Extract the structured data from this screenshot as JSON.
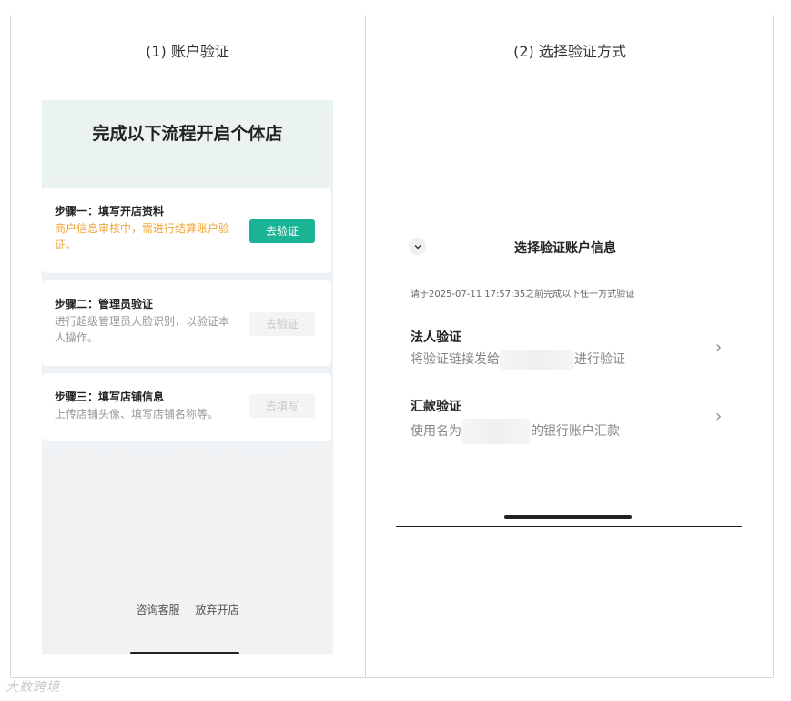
{
  "headers": {
    "col1": "(1) 账户验证",
    "col2": "(2) 选择验证方式"
  },
  "left_phone": {
    "title": "完成以下流程开启个体店",
    "steps": [
      {
        "title": "步骤一：填写开店资料",
        "desc": "商户信息审核中，需进行结算账户验证。",
        "button": "去验证",
        "desc_color": "#f0a53a",
        "button_state": "active"
      },
      {
        "title": "步骤二：管理员验证",
        "desc": "进行超级管理员人脸识别，以验证本人操作。",
        "button": "去验证",
        "button_state": "disabled"
      },
      {
        "title": "步骤三：填写店铺信息",
        "desc": "上传店铺头像、填写店铺名称等。",
        "button": "去填写",
        "button_state": "disabled"
      }
    ],
    "footer": {
      "consult": "咨询客服",
      "abandon": "放弃开店"
    }
  },
  "right_panel": {
    "title": "选择验证账户信息",
    "note": "请于2025-07-11 17:57:35之前完成以下任一方式验证",
    "options": [
      {
        "title": "法人验证",
        "desc_before": "将验证链接发给",
        "desc_after": "进行验证"
      },
      {
        "title": "汇款验证",
        "desc_before": "使用名为",
        "desc_after": "的银行账户汇款"
      }
    ]
  },
  "watermark": "大数跨境",
  "colors": {
    "accent": "#1ab394",
    "warning": "#f0a53a"
  }
}
